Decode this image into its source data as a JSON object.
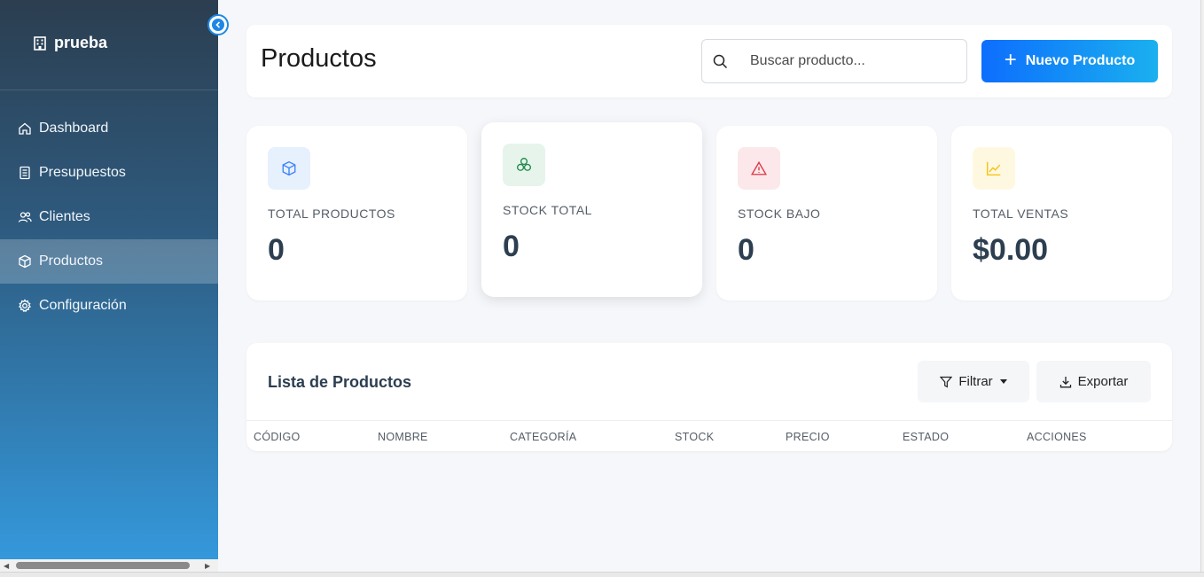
{
  "sidebar": {
    "brand": "prueba",
    "items": [
      {
        "label": "Dashboard",
        "icon": "home-icon"
      },
      {
        "label": "Presupuestos",
        "icon": "document-icon"
      },
      {
        "label": "Clientes",
        "icon": "users-icon"
      },
      {
        "label": "Productos",
        "icon": "box-icon",
        "active": true
      },
      {
        "label": "Configuración",
        "icon": "gear-icon"
      }
    ]
  },
  "header": {
    "title": "Productos",
    "search_placeholder": "Buscar producto...",
    "new_button": "Nuevo Producto"
  },
  "stats": [
    {
      "label": "TOTAL PRODUCTOS",
      "value": "0",
      "icon": "box-icon",
      "color": "#3b82f6",
      "bg": "#e7f0fd"
    },
    {
      "label": "STOCK TOTAL",
      "value": "0",
      "icon": "boxes-icon",
      "color": "#1f8a4c",
      "bg": "#e6f4ec"
    },
    {
      "label": "STOCK BAJO",
      "value": "0",
      "icon": "warning-icon",
      "color": "#dc3545",
      "bg": "#fce8ea"
    },
    {
      "label": "TOTAL VENTAS",
      "value": "$0.00",
      "icon": "chart-line-icon",
      "color": "#f5c518",
      "bg": "#fff8e1"
    }
  ],
  "list": {
    "title": "Lista de Productos",
    "filter_button": "Filtrar",
    "export_button": "Exportar",
    "columns": [
      "CÓDIGO",
      "NOMBRE",
      "CATEGORÍA",
      "STOCK",
      "PRECIO",
      "ESTADO",
      "ACCIONES"
    ]
  }
}
